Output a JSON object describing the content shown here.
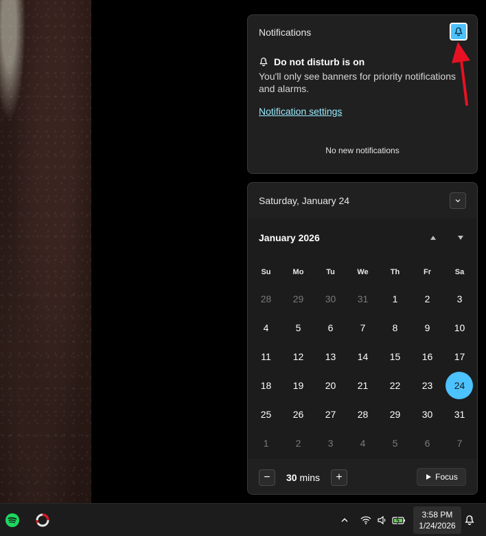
{
  "notifications": {
    "title": "Notifications",
    "dnd_heading": "Do not disturb is on",
    "dnd_description": "You'll only see banners for priority notifications and alarms.",
    "settings_link": "Notification settings",
    "empty_message": "No new notifications"
  },
  "calendar": {
    "date_title": "Saturday, January 24",
    "month_title": "January 2026",
    "weekdays": [
      "Su",
      "Mo",
      "Tu",
      "We",
      "Th",
      "Fr",
      "Sa"
    ],
    "days": [
      {
        "d": "28",
        "muted": true
      },
      {
        "d": "29",
        "muted": true
      },
      {
        "d": "30",
        "muted": true
      },
      {
        "d": "31",
        "muted": true
      },
      {
        "d": "1"
      },
      {
        "d": "2"
      },
      {
        "d": "3"
      },
      {
        "d": "4"
      },
      {
        "d": "5"
      },
      {
        "d": "6"
      },
      {
        "d": "7"
      },
      {
        "d": "8"
      },
      {
        "d": "9"
      },
      {
        "d": "10"
      },
      {
        "d": "11"
      },
      {
        "d": "12"
      },
      {
        "d": "13"
      },
      {
        "d": "14"
      },
      {
        "d": "15"
      },
      {
        "d": "16"
      },
      {
        "d": "17"
      },
      {
        "d": "18"
      },
      {
        "d": "19"
      },
      {
        "d": "20"
      },
      {
        "d": "21"
      },
      {
        "d": "22"
      },
      {
        "d": "23"
      },
      {
        "d": "24",
        "today": true
      },
      {
        "d": "25"
      },
      {
        "d": "26"
      },
      {
        "d": "27"
      },
      {
        "d": "28"
      },
      {
        "d": "29"
      },
      {
        "d": "30"
      },
      {
        "d": "31"
      },
      {
        "d": "1",
        "muted": true
      },
      {
        "d": "2",
        "muted": true
      },
      {
        "d": "3",
        "muted": true
      },
      {
        "d": "4",
        "muted": true
      },
      {
        "d": "5",
        "muted": true
      },
      {
        "d": "6",
        "muted": true
      },
      {
        "d": "7",
        "muted": true
      }
    ]
  },
  "focus": {
    "minus_label": "−",
    "value": "30",
    "unit": "mins",
    "plus_label": "+",
    "button_label": "Focus"
  },
  "taskbar": {
    "time": "3:58 PM",
    "date": "1/24/2026",
    "icons": [
      "spotify-icon",
      "app-ring-icon",
      "chevron-up-icon",
      "wifi-icon",
      "volume-icon",
      "battery-icon",
      "dnd-bell-icon"
    ]
  },
  "colors": {
    "accent": "#4cc2ff",
    "annotation_arrow": "#e81123",
    "link": "#99ebff"
  }
}
